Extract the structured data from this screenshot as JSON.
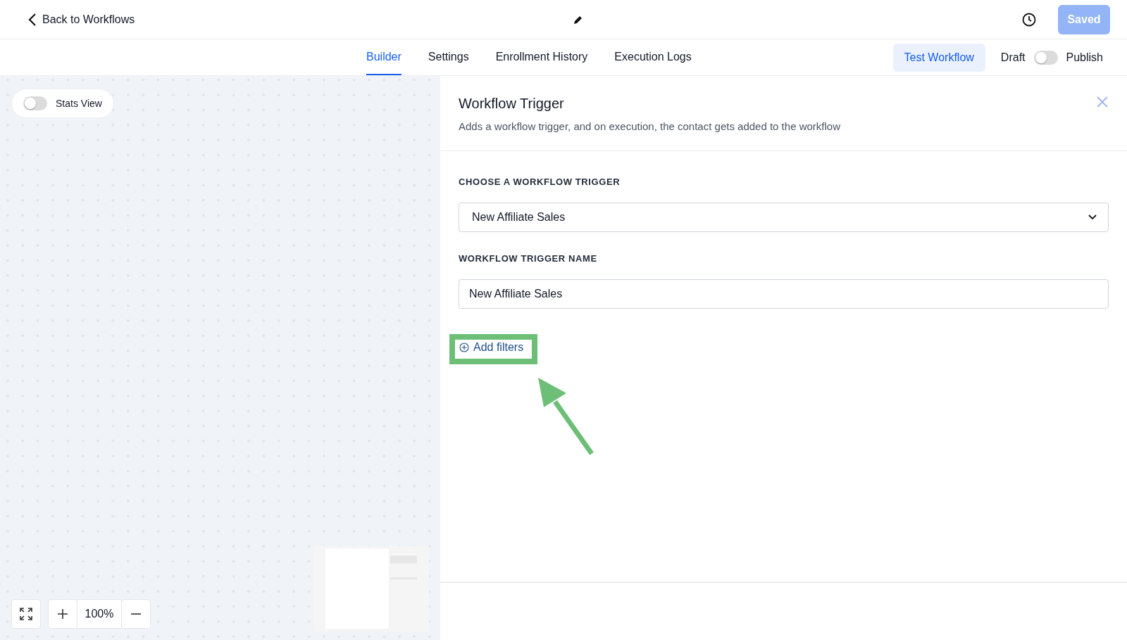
{
  "header": {
    "back_label": "Back to Workflows",
    "saved_label": "Saved"
  },
  "tabs": [
    {
      "label": "Builder",
      "selected": true
    },
    {
      "label": "Settings",
      "selected": false
    },
    {
      "label": "Enrollment History",
      "selected": false
    },
    {
      "label": "Execution Logs",
      "selected": false
    }
  ],
  "test_button": "Test Workflow",
  "publish_toggle": {
    "draft_label": "Draft",
    "publish_label": "Publish",
    "on": false
  },
  "canvas": {
    "stats_toggle": {
      "label": "Stats View",
      "on": false
    },
    "zoom_level": "100%"
  },
  "panel": {
    "title": "Workflow Trigger",
    "description": "Adds a workflow trigger, and on execution, the contact gets added to the workflow",
    "trigger_label": "CHOOSE A WORKFLOW TRIGGER",
    "trigger_value": "New Affiliate Sales",
    "name_label": "WORKFLOW TRIGGER NAME",
    "name_value": "New Affiliate Sales",
    "add_filters_label": "Add filters",
    "highlighted": true
  }
}
